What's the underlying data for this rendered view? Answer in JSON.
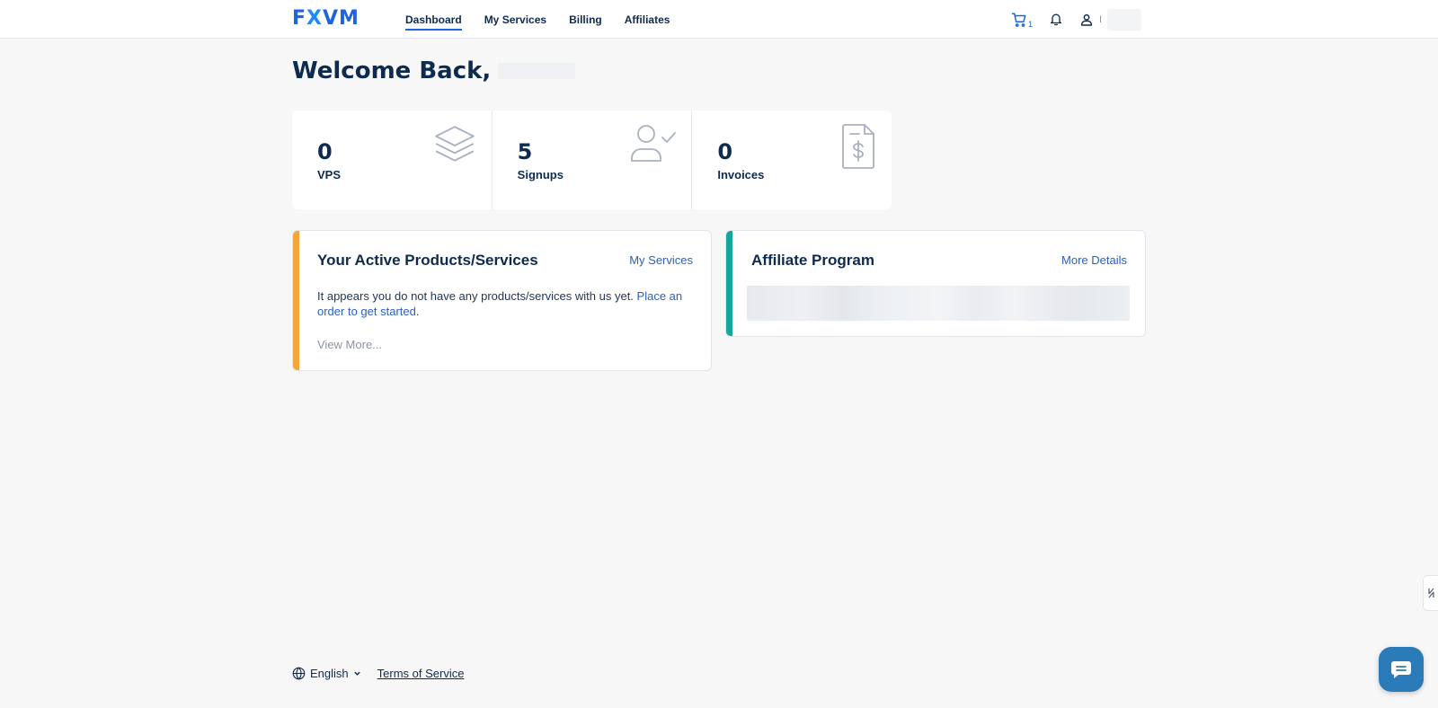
{
  "brand": {
    "logo_text_1": "F",
    "logo_text_2": "X",
    "logo_text_3": "VM"
  },
  "nav": {
    "items": [
      {
        "label": "Dashboard",
        "active": true
      },
      {
        "label": "My Services",
        "active": false
      },
      {
        "label": "Billing",
        "active": false
      },
      {
        "label": "Affiliates",
        "active": false
      }
    ]
  },
  "header": {
    "cart_count": "1",
    "cart_icon": "cart-icon",
    "bell_icon": "bell-icon",
    "user_icon": "user-icon",
    "user_initial": "I"
  },
  "welcome": {
    "text": "Welcome Back,"
  },
  "stats": [
    {
      "value": "0",
      "label": "VPS",
      "icon": "layers-icon"
    },
    {
      "value": "5",
      "label": "Signups",
      "icon": "user-check-icon"
    },
    {
      "value": "0",
      "label": "Invoices",
      "icon": "invoice-icon"
    }
  ],
  "products_card": {
    "title": "Your Active Products/Services",
    "link": "My Services",
    "text_prefix": "It appears you do not have any products/services with us yet. ",
    "text_link_1": "Place an",
    "text_link_2": "order to get started",
    "text_suffix": ".",
    "view_more": "View More...",
    "accent": "#f0a83a"
  },
  "affiliate_card": {
    "title": "Affiliate Program",
    "link": "More Details",
    "accent": "#14a89a"
  },
  "footer": {
    "language": "English",
    "tos": "Terms of Service"
  },
  "colors": {
    "primary": "#1e64e0",
    "text": "#0f2a4f",
    "chat": "#2b7bb9"
  }
}
